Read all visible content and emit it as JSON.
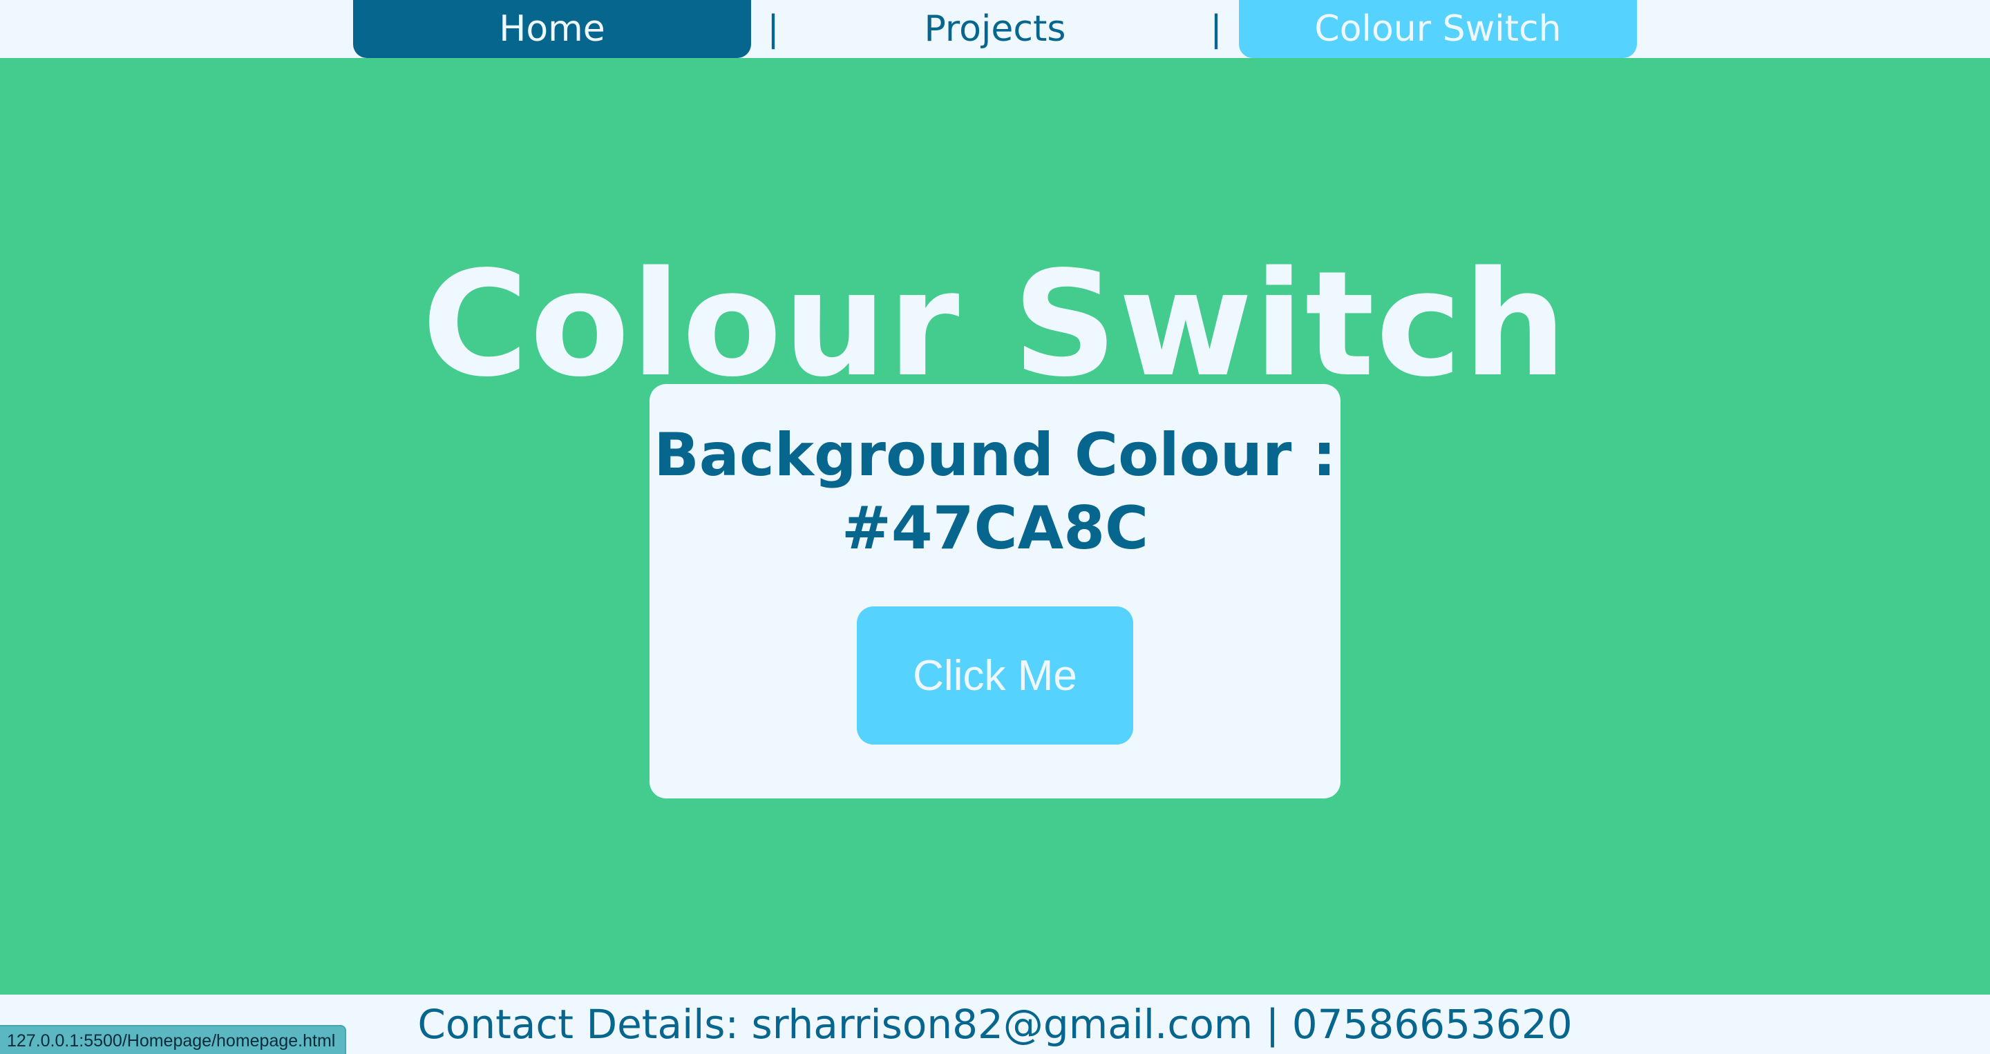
{
  "nav": {
    "home": "Home",
    "separator": "|",
    "projects": "Projects",
    "colour_switch": "Colour Switch"
  },
  "page": {
    "title": "Colour Switch"
  },
  "card": {
    "label": "Background Colour :",
    "value": "#47CA8C",
    "button_label": "Click Me"
  },
  "footer": {
    "contact": "Contact Details: srharrison82@gmail.com | 07586653620"
  },
  "status_bar": {
    "url": "127.0.0.1:5500/Homepage/homepage.html"
  },
  "colors": {
    "background": "#43CC8E",
    "primary": "#06668E",
    "accent": "#55D3FE",
    "light": "#F0F8FF"
  }
}
